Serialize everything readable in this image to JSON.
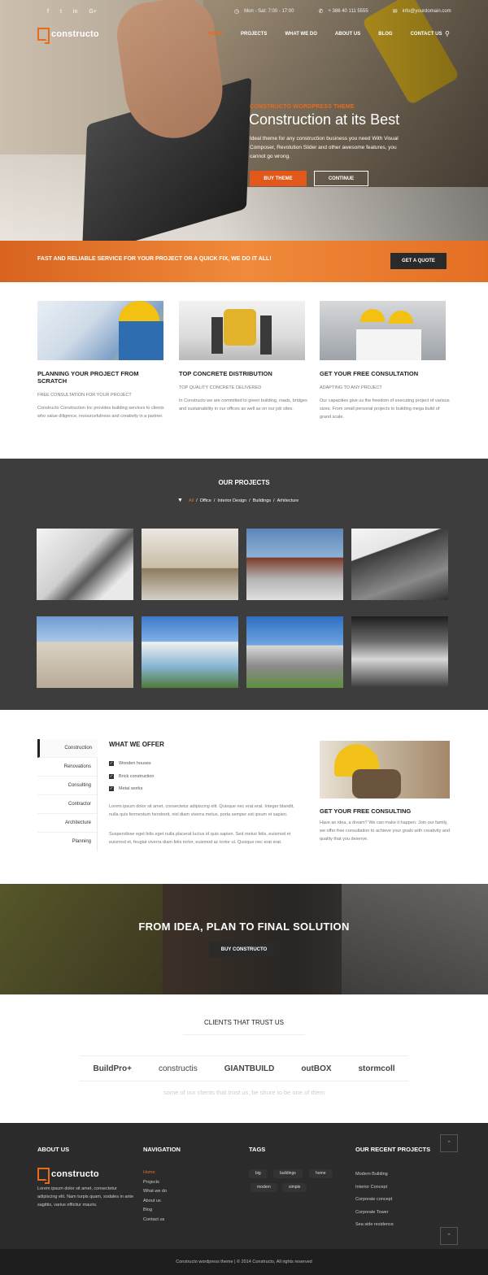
{
  "topbar": {
    "social": [
      "f",
      "t",
      "in",
      "G+"
    ],
    "hours": "Mon - Sat: 7:00 - 17:00",
    "phone": "+ 386 40 111 5555",
    "email": "info@yourdomain.com"
  },
  "brand": {
    "name": "constructo",
    "accent": "#e86a1f"
  },
  "nav": {
    "items": [
      "HOME",
      "PROJECTS",
      "WHAT WE DO",
      "ABOUT US",
      "BLOG",
      "CONTACT US"
    ],
    "active": "HOME"
  },
  "hero": {
    "kicker": "CONSTRUCTO WORDPRESS THEME",
    "title": "Construction at its Best",
    "text": "Ideal theme for any construction business you need With Visual Composer, Revolution Slider and other awesome features, you cannot go wrong.",
    "buy_label": "BUY THEME",
    "continue_label": "CONTINUE"
  },
  "band": {
    "text": "FAST AND RELIABLE SERVICE FOR YOUR PROJECT OR A QUICK FIX, WE DO IT ALL!",
    "button": "GET A QUOTE"
  },
  "services": [
    {
      "title": "PLANNING YOUR PROJECT FROM SCRATCH",
      "sub": "FREE CONSULTATION FOR YOUR PROJECT",
      "text": "Constructo Construction Inc provides building services to clients who value diligence, resourcefulness and creativity in a partner."
    },
    {
      "title": "TOP CONCRETE DISTRIBUTION",
      "sub": "TOP QUALITY CONCRETE DELIVERED",
      "text": "In Constructo we are committed to green building, roads, bridges and sustainability in our offices as well as on our job sites."
    },
    {
      "title": "GET YOUR FREE CONSULTATION",
      "sub": "ADAPTING TO ANY PROJECT",
      "text": "Our capacities give us the freedom of executing project of various sizes. From small personal projects to building mega build of grand scale."
    }
  ],
  "projects": {
    "title": "OUR PROJECTS",
    "filters": [
      "All",
      "Office",
      "Interior Design",
      "Buildings",
      "Arhitecture"
    ],
    "active_filter": "All"
  },
  "offer": {
    "tabs": [
      "Construction",
      "Renovations",
      "Consulting",
      "Contractor",
      "Architecture",
      "Planning"
    ],
    "active_tab": "Construction",
    "title": "WHAT WE OFFER",
    "checks": [
      "Wooden houses",
      "Brick construction",
      "Metal works"
    ],
    "p1": "Lorem ipsum dolor sit amet, consectetur adipiscing elit. Quisque nec erat erat. Integer blandit, nulla quis fermentum hendrerit, nisl diam viverra metus, porta semper est ipsum et sapien.",
    "p2": "Suspendisse eget felis eget nulla placerat luctus id quis sapien. Sed metus felis, euismod et euismod et, feugiat viverra diam felis tortor, euismod ac tortor ut. Quisque nec erat erat.",
    "consult_title": "GET YOUR FREE CONSULTING",
    "consult_text": "Have an idea, a dream? We can make it happen. Join our family, we offer free consultation to achieve your goals with creativity and quality that you deserve."
  },
  "cta": {
    "title": "FROM IDEA, PLAN TO FINAL SOLUTION",
    "button": "BUY CONSTRUCTO"
  },
  "clients": {
    "title": "CLIENTS THAT TRUST US",
    "logos": [
      "BuildPro+",
      "constructis",
      "GIANTBUILD",
      "outBOX",
      "stormcoll"
    ],
    "footer": "some of our clients that trust us, be shure to be one of them"
  },
  "footer": {
    "about_title": "ABOUT US",
    "about_text": "Lorem ipsum dolor sit amet, consectetur adipiscing elit. Nam turpis quam, sodales in ante sagittis, varius efficitur mauris.",
    "nav_title": "NAVIGATION",
    "nav_items": [
      "Home",
      "Projects",
      "What we do",
      "About us",
      "Blog",
      "Contact us"
    ],
    "tags_title": "TAGS",
    "tags": [
      "big",
      "buildings",
      "home",
      "modern",
      "simple"
    ],
    "recent_title": "OUR RECENT PROJECTS",
    "recent": [
      "Modern Building",
      "Interior Concept",
      "Corporate concept",
      "Corporate Tower",
      "Sea side residence"
    ],
    "copyright": "Constructo wordpress theme | © 2014 Constructo, All rights reserved"
  }
}
